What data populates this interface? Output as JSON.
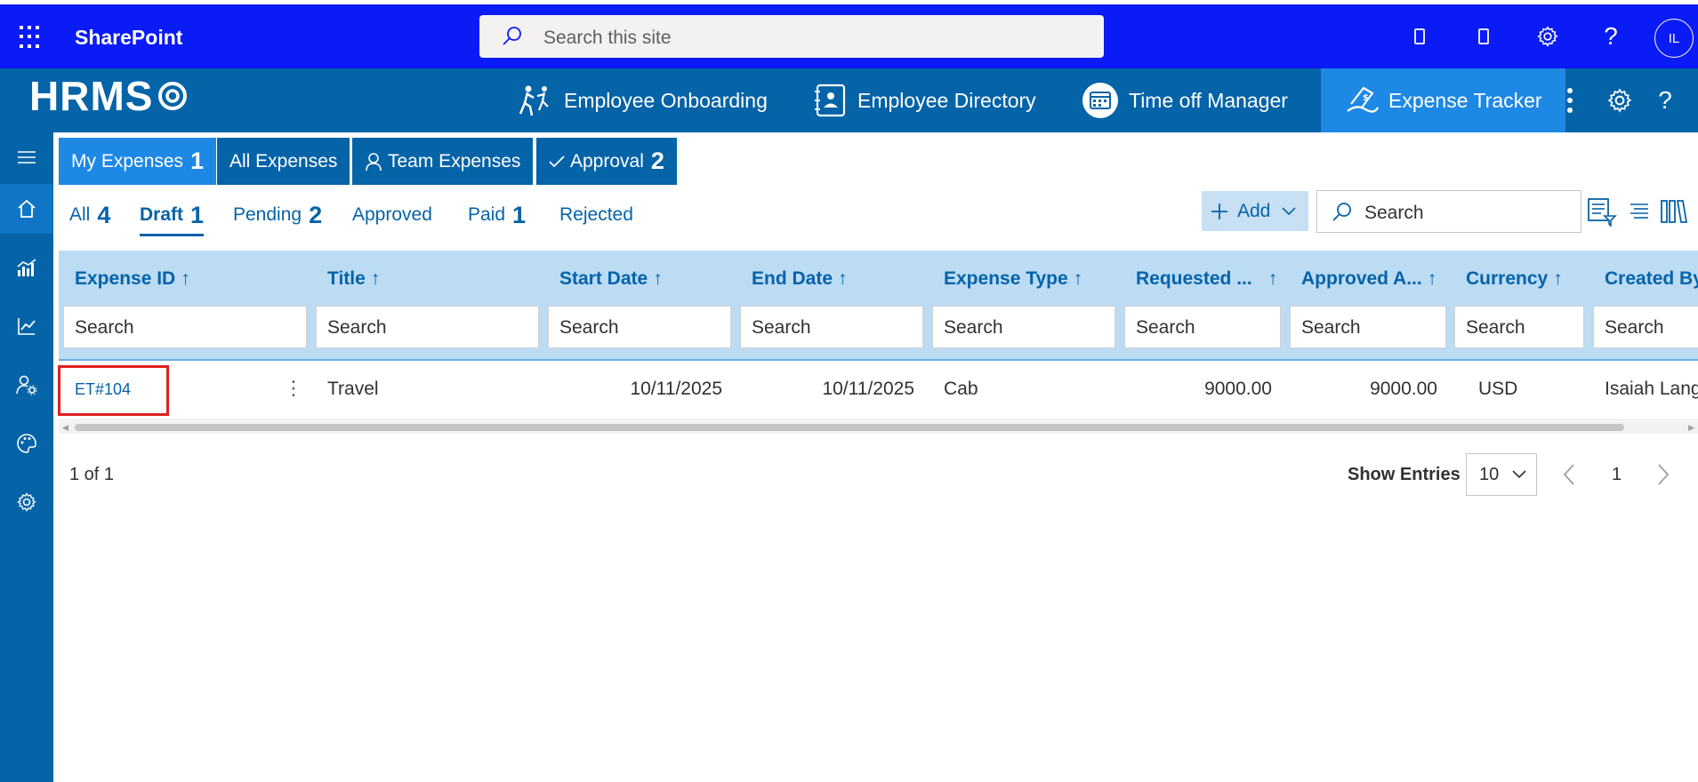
{
  "suitebar": {
    "title": "SharePoint",
    "search_placeholder": "Search this site",
    "avatar_initials": "IL"
  },
  "app": {
    "logo": "HRMS",
    "nav": [
      {
        "label": "Employee Onboarding",
        "icon": "onboarding-icon"
      },
      {
        "label": "Employee Directory",
        "icon": "directory-icon"
      },
      {
        "label": "Time off Manager",
        "icon": "calendar-icon"
      },
      {
        "label": "Expense Tracker",
        "icon": "expense-icon",
        "active": true
      }
    ]
  },
  "rail": [
    "menu-icon",
    "home-icon",
    "analytics-icon",
    "chart-icon",
    "user-settings-icon",
    "palette-icon",
    "gear-icon"
  ],
  "tabs": [
    {
      "label": "My Expenses",
      "count": "1",
      "active": true
    },
    {
      "label": "All Expenses",
      "count": ""
    },
    {
      "label": "Team Expenses",
      "count": ""
    },
    {
      "label": "Approval",
      "count": "2"
    }
  ],
  "subtabs": [
    {
      "label": "All",
      "count": "4"
    },
    {
      "label": "Draft",
      "count": "1",
      "active": true
    },
    {
      "label": "Pending",
      "count": "2"
    },
    {
      "label": "Approved",
      "count": ""
    },
    {
      "label": "Paid",
      "count": "1"
    },
    {
      "label": "Rejected",
      "count": ""
    }
  ],
  "toolbar": {
    "add_label": "Add",
    "search_placeholder": "Search"
  },
  "grid": {
    "sort_arrow": "↑",
    "filter_placeholder": "Search",
    "columns": [
      "Expense ID",
      "Title",
      "Start Date",
      "End Date",
      "Expense Type",
      "Requested ...",
      "Approved A...",
      "Currency",
      "Created By"
    ],
    "rows": [
      {
        "expense_id": "ET#104",
        "title": "Travel",
        "start_date": "10/11/2025",
        "end_date": "10/11/2025",
        "expense_type": "Cab",
        "requested": "9000.00",
        "approved": "9000.00",
        "currency": "USD",
        "created_by": "Isaiah Langer"
      }
    ]
  },
  "pagination": {
    "info": "1 of 1",
    "show_entries_label": "Show Entries",
    "entries_value": "10",
    "current_page": "1"
  },
  "colors": {
    "suitebar": "#0a1bf5",
    "app_header": "#0563a8",
    "active_tab": "#1e88e5",
    "grid_header": "#bcdcf4",
    "highlight": "#e02020"
  }
}
